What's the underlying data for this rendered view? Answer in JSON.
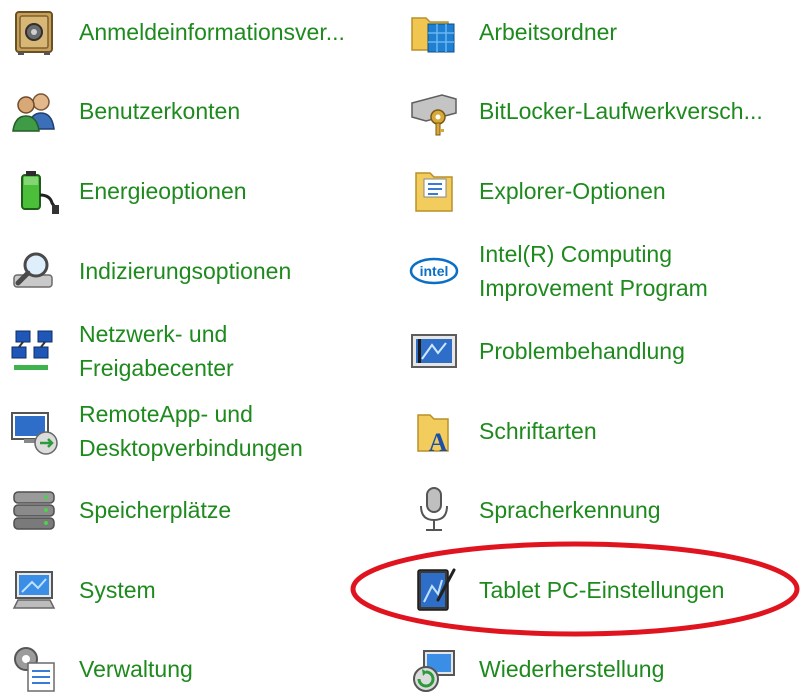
{
  "control_panel": {
    "items_left": [
      {
        "label": "Anmeldeinformationsver...",
        "icon": "safe-icon"
      },
      {
        "label": "Benutzerkonten",
        "icon": "users-icon"
      },
      {
        "label": "Energieoptionen",
        "icon": "battery-icon"
      },
      {
        "label": "Indizierungsoptionen",
        "icon": "indexing-magnifier-icon"
      },
      {
        "label": "Netzwerk- und\nFreigabecenter",
        "icon": "network-icon"
      },
      {
        "label": "RemoteApp- und\nDesktopverbindungen",
        "icon": "remote-desktop-icon"
      },
      {
        "label": "Speicherplätze",
        "icon": "storage-stack-icon"
      },
      {
        "label": "System",
        "icon": "computer-icon"
      },
      {
        "label": "Verwaltung",
        "icon": "admin-tools-icon"
      }
    ],
    "items_right": [
      {
        "label": "Arbeitsordner",
        "icon": "work-folders-icon"
      },
      {
        "label": "BitLocker-Laufwerkversch...",
        "icon": "bitlocker-drive-key-icon"
      },
      {
        "label": "Explorer-Optionen",
        "icon": "folder-options-icon"
      },
      {
        "label": "Intel(R) Computing\nImprovement Program",
        "icon": "intel-logo-icon"
      },
      {
        "label": "Problembehandlung",
        "icon": "troubleshooting-icon"
      },
      {
        "label": "Schriftarten",
        "icon": "fonts-folder-icon"
      },
      {
        "label": "Spracherkennung",
        "icon": "microphone-icon"
      },
      {
        "label": "Tablet PC-Einstellungen",
        "icon": "tablet-pen-icon"
      },
      {
        "label": "Wiederherstellung",
        "icon": "recovery-icon"
      }
    ],
    "highlighted_item": "Tablet PC-Einstellungen",
    "colors": {
      "link_text": "#1e8a1e",
      "highlight_ellipse": "#e0141e",
      "background": "#ffffff"
    }
  }
}
